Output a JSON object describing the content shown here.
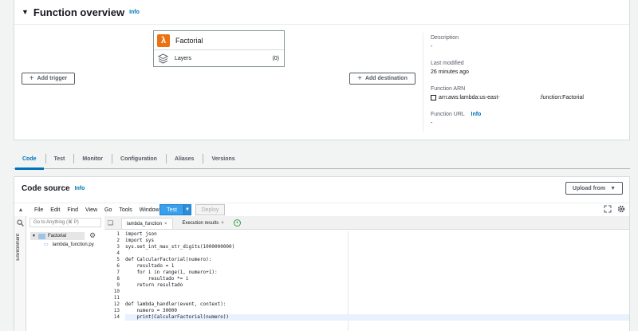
{
  "overview": {
    "title": "Function overview",
    "info": "Info",
    "function_name": "Factorial",
    "layers_label": "Layers",
    "layers_count": "(0)",
    "add_trigger": "Add trigger",
    "add_destination": "Add destination",
    "meta": [
      {
        "label": "Description",
        "value": "-"
      },
      {
        "label": "Last modified",
        "value": "26 minutes ago"
      },
      {
        "label": "Function ARN",
        "value": "arn:aws:lambda:us-east-"
      },
      {
        "label": "Function URL",
        "value": "-"
      }
    ],
    "arn_suffix": ":function:Factorial",
    "url_info": "Info"
  },
  "tabs": [
    "Code",
    "Test",
    "Monitor",
    "Configuration",
    "Aliases",
    "Versions"
  ],
  "code_source": {
    "title": "Code source",
    "info": "Info",
    "upload_from": "Upload from"
  },
  "ide": {
    "menu": [
      "File",
      "Edit",
      "Find",
      "View",
      "Go",
      "Tools",
      "Window"
    ],
    "test_label": "Test",
    "deploy_label": "Deploy",
    "goto_placeholder": "Go to Anything (⌘ P)",
    "environment_label": "Environment",
    "folder": "Factorial",
    "file": "lambda_function.py",
    "editor_tabs": [
      "lambda_function",
      "Execution results"
    ],
    "line_numbers": [
      "1",
      "2",
      "3",
      "4",
      "5",
      "6",
      "7",
      "8",
      "9",
      "10",
      "11",
      "12",
      "13",
      "14"
    ],
    "code_lines": [
      "import json",
      "import sys",
      "sys.set_int_max_str_digits(1000000000)",
      "",
      "def CalcularFactorial(numero):",
      "    resultado = 1",
      "    for i in range(1, numero+1):",
      "        resultado *= i",
      "    return resultado",
      "",
      "",
      "def lambda_handler(event, context):",
      "    numero = 30000",
      "    print(CalcularFactorial(numero))"
    ]
  },
  "colors": {
    "accent": "#0073bb",
    "lambda_orange": "#ec7211",
    "test_button": "#39a0ed"
  }
}
